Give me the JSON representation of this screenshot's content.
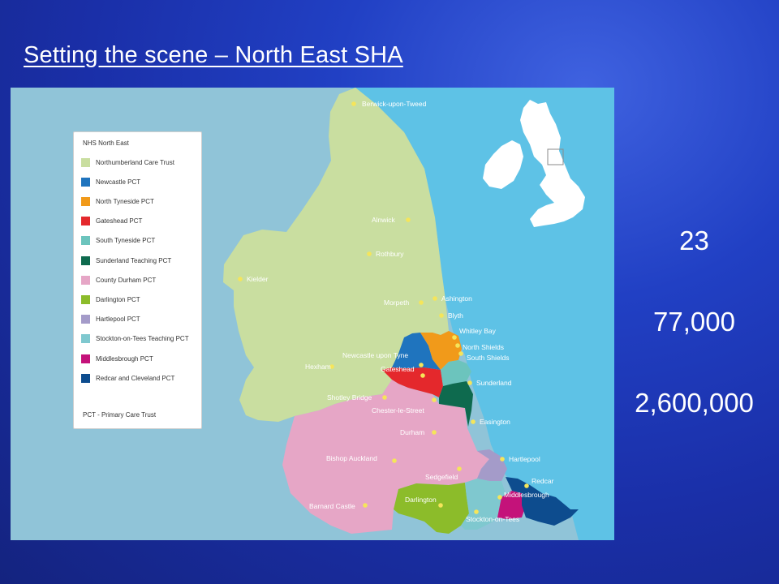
{
  "slide": {
    "title": "Setting the scene – North East SHA"
  },
  "legend": {
    "title": "NHS North East",
    "items": [
      {
        "label": "Northumberland Care Trust",
        "color": "#c9dea0"
      },
      {
        "label": "Newcastle PCT",
        "color": "#1f74be"
      },
      {
        "label": "North Tyneside PCT",
        "color": "#f19a1a"
      },
      {
        "label": "Gateshead PCT",
        "color": "#e4282c"
      },
      {
        "label": "South Tyneside PCT",
        "color": "#6cc4bd"
      },
      {
        "label": "Sunderland Teaching PCT",
        "color": "#0e6a4e"
      },
      {
        "label": "County Durham PCT",
        "color": "#e6a6c6"
      },
      {
        "label": "Darlington PCT",
        "color": "#8cbc2a"
      },
      {
        "label": "Hartlepool PCT",
        "color": "#a49bc9"
      },
      {
        "label": "Stockton-on-Tees Teaching PCT",
        "color": "#7fc8cf"
      },
      {
        "label": "Middlesbrough PCT",
        "color": "#c4127a"
      },
      {
        "label": "Redcar and Cleveland PCT",
        "color": "#0d4c8e"
      }
    ],
    "footnote": "PCT - Primary Care Trust"
  },
  "places": [
    {
      "name": "Berwick-upon-Tweed"
    },
    {
      "name": "Alnwick"
    },
    {
      "name": "Rothbury"
    },
    {
      "name": "Kielder"
    },
    {
      "name": "Ashington"
    },
    {
      "name": "Morpeth"
    },
    {
      "name": "Blyth"
    },
    {
      "name": "Whitley Bay"
    },
    {
      "name": "North Shields"
    },
    {
      "name": "South Shields"
    },
    {
      "name": "Newcastle upon Tyne"
    },
    {
      "name": "Hexham"
    },
    {
      "name": "Gateshead"
    },
    {
      "name": "Sunderland"
    },
    {
      "name": "Shotley Bridge"
    },
    {
      "name": "Chester-le-Street"
    },
    {
      "name": "Easington"
    },
    {
      "name": "Durham"
    },
    {
      "name": "Bishop Auckland"
    },
    {
      "name": "Hartlepool"
    },
    {
      "name": "Sedgefield"
    },
    {
      "name": "Redcar"
    },
    {
      "name": "Middlesbrough"
    },
    {
      "name": "Darlington"
    },
    {
      "name": "Barnard Castle"
    },
    {
      "name": "Stockton-on-Tees"
    }
  ],
  "stats": {
    "value_1": "23",
    "value_2": "77,000",
    "value_3": "2,600,000"
  },
  "colors": {
    "sea": "#5ec2e6",
    "land_outside": "#90c4d8",
    "inset_land": "#ffffff",
    "place_dot": "#f5e55a"
  }
}
